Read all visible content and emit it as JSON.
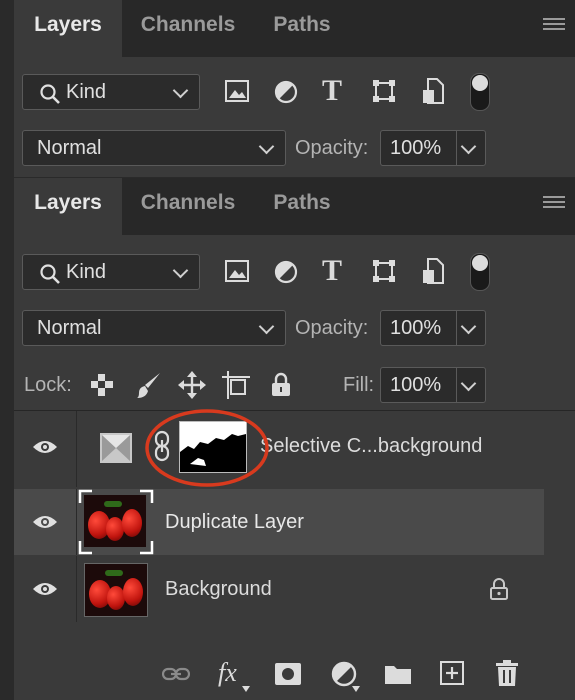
{
  "panel1": {
    "tabs": [
      "Layers",
      "Channels",
      "Paths"
    ],
    "filter_label": "Kind",
    "blend_mode": "Normal",
    "opacity_label": "Opacity:",
    "opacity_value": "100%"
  },
  "panel2": {
    "tabs": [
      "Layers",
      "Channels",
      "Paths"
    ],
    "filter_label": "Kind",
    "blend_mode": "Normal",
    "opacity_label": "Opacity:",
    "opacity_value": "100%",
    "lock_label": "Lock:",
    "fill_label": "Fill:",
    "fill_value": "100%",
    "layers": [
      {
        "name": "Selective C...background",
        "visible": true,
        "type": "adjustment",
        "selected": false,
        "locked": false
      },
      {
        "name": "Duplicate Layer",
        "visible": true,
        "type": "pixel",
        "selected": true,
        "locked": false
      },
      {
        "name": "Background",
        "visible": true,
        "type": "pixel",
        "selected": false,
        "locked": true
      }
    ]
  },
  "footer_icons": [
    "link-icon",
    "fx-icon",
    "mask-icon",
    "adjustment-icon",
    "folder-icon",
    "new-layer-icon",
    "trash-icon"
  ],
  "colors": {
    "annotation_circle": "#d83a1e",
    "selected_row": "#4a4a4a",
    "panel_bg": "#3a3a3a"
  }
}
